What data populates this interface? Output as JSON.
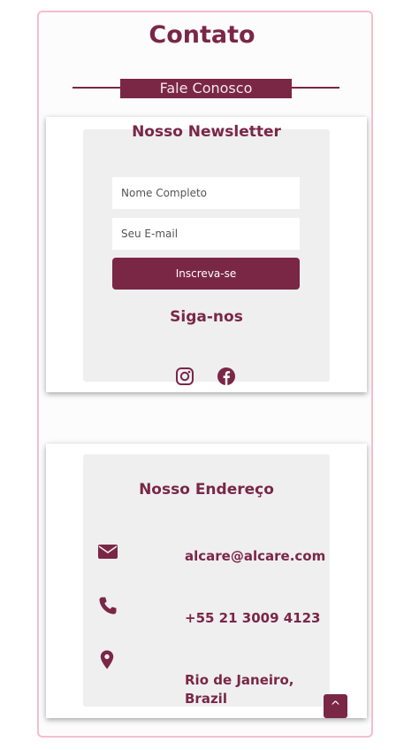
{
  "page": {
    "title": "Contato"
  },
  "banner": {
    "label": "Fale Conosco"
  },
  "newsletter": {
    "title": "Nosso Newsletter",
    "name_placeholder": "Nome Completo",
    "email_placeholder": "Seu E-mail",
    "submit_label": "Inscreva-se",
    "follow_title": "Siga-nos",
    "social": [
      {
        "icon": "instagram-icon"
      },
      {
        "icon": "facebook-icon"
      }
    ]
  },
  "address": {
    "title": "Nosso Endereço",
    "items": [
      {
        "icon": "envelope-icon",
        "text": "alcare@alcare.com"
      },
      {
        "icon": "phone-icon",
        "text": "+55 21 3009 4123"
      },
      {
        "icon": "map-marker-icon",
        "text": "Rio de Janeiro, Brazil"
      }
    ]
  },
  "scroll_top": {
    "label": "^"
  },
  "colors": {
    "accent": "#7a2746",
    "panel": "#efefef",
    "frame_border": "#f3bfcb"
  }
}
